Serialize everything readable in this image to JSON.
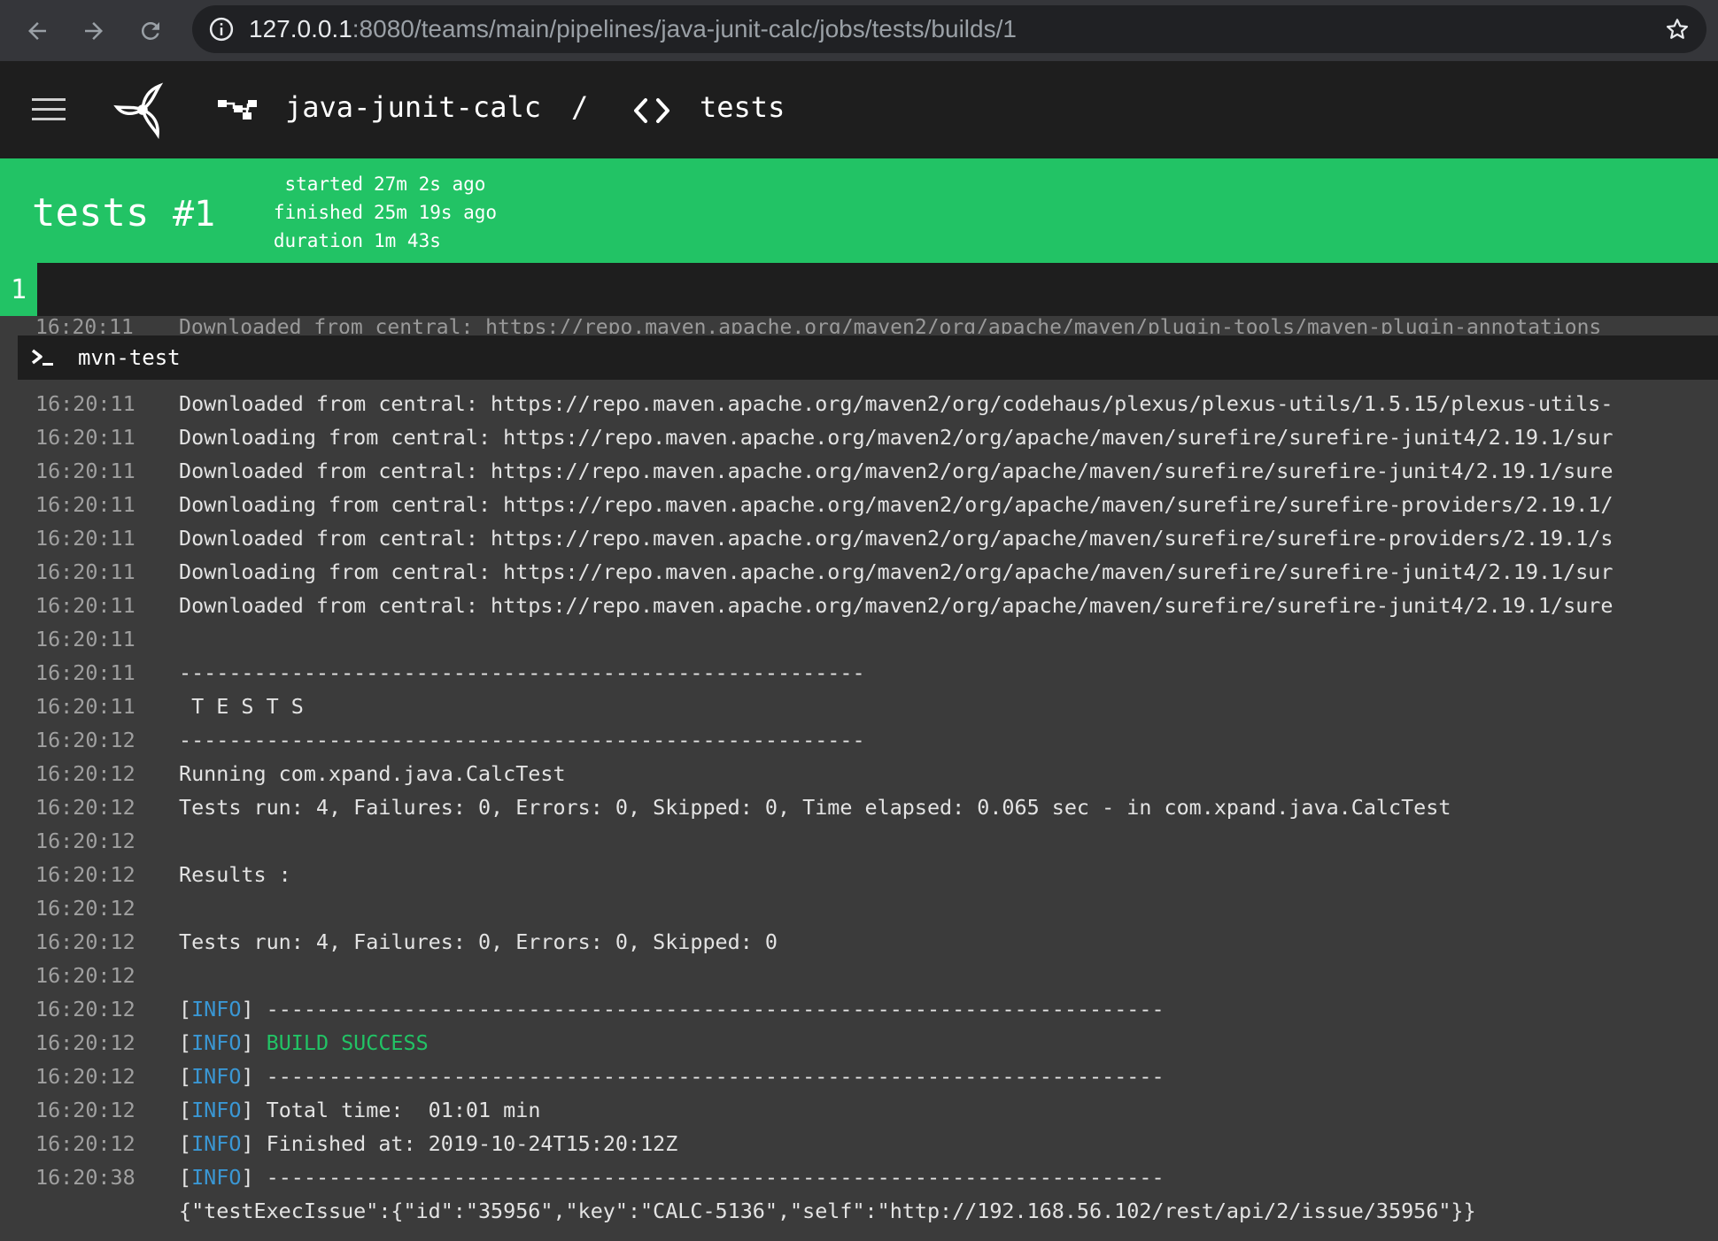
{
  "browser": {
    "url_host": "127.0.0.1",
    "url_path": ":8080/teams/main/pipelines/java-junit-calc/jobs/tests/builds/1"
  },
  "header": {
    "pipeline_name": "java-junit-calc",
    "separator": "/",
    "job_name": "tests"
  },
  "build": {
    "job": "tests",
    "number": "#1",
    "meta": [
      {
        "key": "started",
        "value": "27m 2s ago"
      },
      {
        "key": "finished",
        "value": "25m 19s ago"
      },
      {
        "key": "duration",
        "value": "1m 43s"
      }
    ],
    "tabs": [
      "1"
    ]
  },
  "log": {
    "ghost_line": {
      "ts": "16:20:11",
      "msg": "Downloaded from central: https://repo.maven.apache.org/maven2/org/apache/maven/plugin-tools/maven-plugin-annotations"
    },
    "step_name": "mvn-test",
    "lines": [
      {
        "ts": "16:20:11",
        "msg": "Downloaded from central: https://repo.maven.apache.org/maven2/org/codehaus/plexus/plexus-utils/1.5.15/plexus-utils-"
      },
      {
        "ts": "16:20:11",
        "msg": "Downloading from central: https://repo.maven.apache.org/maven2/org/apache/maven/surefire/surefire-junit4/2.19.1/sur"
      },
      {
        "ts": "16:20:11",
        "msg": "Downloaded from central: https://repo.maven.apache.org/maven2/org/apache/maven/surefire/surefire-junit4/2.19.1/sure"
      },
      {
        "ts": "16:20:11",
        "msg": "Downloading from central: https://repo.maven.apache.org/maven2/org/apache/maven/surefire/surefire-providers/2.19.1/"
      },
      {
        "ts": "16:20:11",
        "msg": "Downloaded from central: https://repo.maven.apache.org/maven2/org/apache/maven/surefire/surefire-providers/2.19.1/s"
      },
      {
        "ts": "16:20:11",
        "msg": "Downloading from central: https://repo.maven.apache.org/maven2/org/apache/maven/surefire/surefire-junit4/2.19.1/sur"
      },
      {
        "ts": "16:20:11",
        "msg": "Downloaded from central: https://repo.maven.apache.org/maven2/org/apache/maven/surefire/surefire-junit4/2.19.1/sure"
      },
      {
        "ts": "16:20:11",
        "msg": ""
      },
      {
        "ts": "16:20:11",
        "msg": "-------------------------------------------------------"
      },
      {
        "ts": "16:20:11",
        "msg": " T E S T S"
      },
      {
        "ts": "16:20:12",
        "msg": "-------------------------------------------------------"
      },
      {
        "ts": "16:20:12",
        "msg": "Running com.xpand.java.CalcTest"
      },
      {
        "ts": "16:20:12",
        "msg": "Tests run: 4, Failures: 0, Errors: 0, Skipped: 0, Time elapsed: 0.065 sec - in com.xpand.java.CalcTest"
      },
      {
        "ts": "16:20:12",
        "msg": ""
      },
      {
        "ts": "16:20:12",
        "msg": "Results :"
      },
      {
        "ts": "16:20:12",
        "msg": ""
      },
      {
        "ts": "16:20:12",
        "msg": "Tests run: 4, Failures: 0, Errors: 0, Skipped: 0"
      },
      {
        "ts": "16:20:12",
        "msg": ""
      },
      {
        "ts": "16:20:12",
        "tag": "INFO",
        "msg": "------------------------------------------------------------------------"
      },
      {
        "ts": "16:20:12",
        "tag": "INFO",
        "msg": "BUILD SUCCESS",
        "success": true
      },
      {
        "ts": "16:20:12",
        "tag": "INFO",
        "msg": "------------------------------------------------------------------------"
      },
      {
        "ts": "16:20:12",
        "tag": "INFO",
        "msg": "Total time:  01:01 min"
      },
      {
        "ts": "16:20:12",
        "tag": "INFO",
        "msg": "Finished at: 2019-10-24T15:20:12Z"
      },
      {
        "ts": "16:20:38",
        "tag": "INFO",
        "msg": "------------------------------------------------------------------------"
      },
      {
        "ts": "",
        "msg": "{\"testExecIssue\":{\"id\":\"35956\",\"key\":\"CALC-5136\",\"self\":\"http://192.168.56.102/rest/api/2/issue/35956\"}}"
      }
    ]
  },
  "colors": {
    "success_green": "#22c365",
    "info_blue": "#3a97d4",
    "header_bg": "#1e1e1e",
    "log_bg": "#3b3b3b"
  }
}
